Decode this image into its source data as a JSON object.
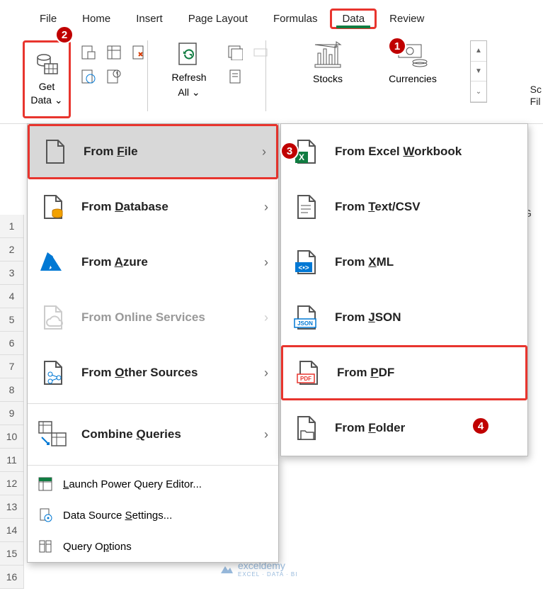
{
  "tabs": {
    "file": "File",
    "home": "Home",
    "insert": "Insert",
    "pageLayout": "Page Layout",
    "formulas": "Formulas",
    "data": "Data",
    "review": "Review"
  },
  "toolbar": {
    "getData1": "Get",
    "getData2": "Data ⌄",
    "refresh1": "Refresh",
    "refresh2": "All ⌄",
    "stocks": "Stocks",
    "currencies": "Currencies",
    "sortfilter1": "Sc",
    "sortfilter2": "Fil"
  },
  "menu1": {
    "fromFile": "From File",
    "fromDatabase": "From Database",
    "fromAzure": "From Azure",
    "fromOnline": "From Online Services",
    "fromOther": "From Other Sources",
    "combine": "Combine Queries",
    "launch": "Launch Power Query Editor...",
    "dsSettings": "Data Source Settings...",
    "qOptions": "Query Options"
  },
  "menu2": {
    "workbook": "From Excel Workbook",
    "textcsv": "From Text/CSV",
    "xml": "From XML",
    "json": "From JSON",
    "pdf": "From PDF",
    "folder": "From Folder"
  },
  "callouts": {
    "c1": "1",
    "c2": "2",
    "c3": "3",
    "c4": "4"
  },
  "colG": "G",
  "rows": [
    "1",
    "2",
    "3",
    "4",
    "5",
    "6",
    "7",
    "8",
    "9",
    "10",
    "11",
    "12",
    "13",
    "14",
    "15",
    "16"
  ],
  "watermark": {
    "name": "exceldemy",
    "sub": "EXCEL · DATA · BI"
  }
}
